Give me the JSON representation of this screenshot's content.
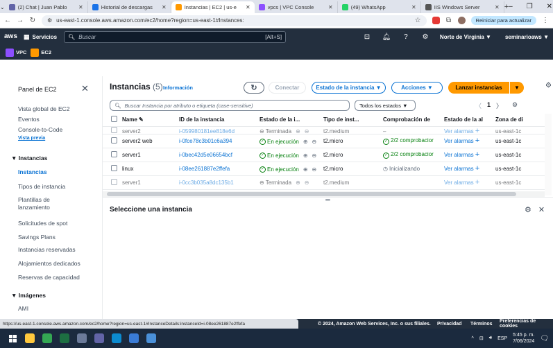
{
  "browser": {
    "tabs": [
      {
        "title": "(2) Chat | Juan Pablo",
        "color": "#6264a7"
      },
      {
        "title": "Historial de descargas",
        "color": "#1a73e8"
      },
      {
        "title": "Instancias | EC2 | us-e",
        "color": "#ff9900",
        "active": true
      },
      {
        "title": "vpcs | VPC Console",
        "color": "#8c4fff"
      },
      {
        "title": "(49) WhatsApp",
        "color": "#25d366"
      },
      {
        "title": "IIS Windows Server",
        "color": "#555555"
      }
    ],
    "url": "us-east-1.console.aws.amazon.com/ec2/home?region=us-east-1#Instances:",
    "reload_button": "Reiniciar para actualizar"
  },
  "aws_nav": {
    "logo": "aws",
    "services": "Servicios",
    "search_placeholder": "Buscar",
    "search_shortcut": "[Alt+S]",
    "region": "Norte de Virginia ▼",
    "account": "seminarioaws ▼"
  },
  "favorites": [
    {
      "label": "VPC",
      "color": "#8c4fff"
    },
    {
      "label": "EC2",
      "color": "#ff9900"
    }
  ],
  "sidebar": {
    "title": "Panel de EC2",
    "items": [
      {
        "label": "Vista global de EC2",
        "type": "item"
      },
      {
        "label": "Eventos",
        "type": "item"
      },
      {
        "label": "Console-to-Code",
        "badge": "Vista previa",
        "type": "item"
      },
      {
        "label": "▼ Instancias",
        "type": "section"
      },
      {
        "label": "Instancias",
        "type": "selected"
      },
      {
        "label": "Tipos de instancia",
        "type": "item"
      },
      {
        "label": "Plantillas de lanzamiento",
        "type": "item"
      },
      {
        "label": "Solicitudes de spot",
        "type": "item"
      },
      {
        "label": "Savings Plans",
        "type": "item"
      },
      {
        "label": "Instancias reservadas",
        "type": "item"
      },
      {
        "label": "Alojamientos dedicados",
        "type": "item"
      },
      {
        "label": "Reservas de capacidad",
        "type": "item"
      },
      {
        "label": "▼ Imágenes",
        "type": "section"
      },
      {
        "label": "AMI",
        "type": "item"
      }
    ]
  },
  "instances": {
    "title": "Instancias",
    "count": "(5)",
    "info_link": "Información",
    "connect_button": "Conectar",
    "state_button": "Estado de la instancia ▼",
    "actions_button": "Acciones ▼",
    "launch_button": "Lanzar instancias",
    "search_placeholder": "Buscar Instancia por atributo o etiqueta (case-sensitive)",
    "state_filter": "Todos los estados ▼",
    "page": "1",
    "columns": [
      "Name ✎",
      "ID de la instancia",
      "Estado de la i...",
      "Tipo de inst...",
      "Comprobación de",
      "Estado de la al",
      "Zona de di"
    ],
    "rows": [
      {
        "name": "server2",
        "id": "i-059980181ee818e6d",
        "state": "Terminada",
        "type": "t2.medium",
        "check": "–",
        "alarm": "Ver alarmas",
        "zone": "us-east-1c"
      },
      {
        "name": "server2 web",
        "id": "i-0fce78c3b01c6a394",
        "state": "En ejecución",
        "type": "t2.micro",
        "check": "2/2 comprobacior",
        "alarm": "Ver alarmas",
        "zone": "us-east-1c"
      },
      {
        "name": "server1",
        "id": "i-0bec42d5e06654bcf",
        "state": "En ejecución",
        "type": "t2.micro",
        "check": "2/2 comprobacior",
        "alarm": "Ver alarmas",
        "zone": "us-east-1c"
      },
      {
        "name": "linux",
        "id": "i-08ee261887e2ffefa",
        "state": "En ejecución",
        "type": "t2.micro",
        "check": "Inicializando",
        "alarm": "Ver alarmas",
        "zone": "us-east-1c"
      },
      {
        "name": "server1",
        "id": "i-0cc3b035a8dc135b1",
        "state": "Terminada",
        "type": "t2.medium",
        "check": "",
        "alarm": "Ver alarmas",
        "zone": "us-east-1c"
      }
    ]
  },
  "detail": {
    "title": "Seleccione una instancia"
  },
  "footer": {
    "status_url": "https://us-east-1.console.aws.amazon.com/ec2/home?region=us-east-1#InstanceDetails:instanceId=i-08ee261887e2ffefa",
    "copyright": "© 2024, Amazon Web Services, Inc. o sus filiales.",
    "privacy": "Privacidad",
    "terms": "Términos",
    "cookies": "Preferencias de cookies"
  },
  "taskbar": {
    "lang": "ESP",
    "time": "5:45 p. m.",
    "date": "7/06/2024",
    "apps": [
      {
        "name": "start",
        "color": "#ffffff"
      },
      {
        "name": "file-explorer",
        "color": "#ffc83d"
      },
      {
        "name": "chrome",
        "color": "#34a853"
      },
      {
        "name": "excel",
        "color": "#1d6f42"
      },
      {
        "name": "app",
        "color": "#6b7a99"
      },
      {
        "name": "teams",
        "color": "#6264a7"
      },
      {
        "name": "edge",
        "color": "#0c8bd0"
      },
      {
        "name": "app2",
        "color": "#3a7bd5"
      },
      {
        "name": "app3",
        "color": "#4a90d9"
      }
    ]
  }
}
